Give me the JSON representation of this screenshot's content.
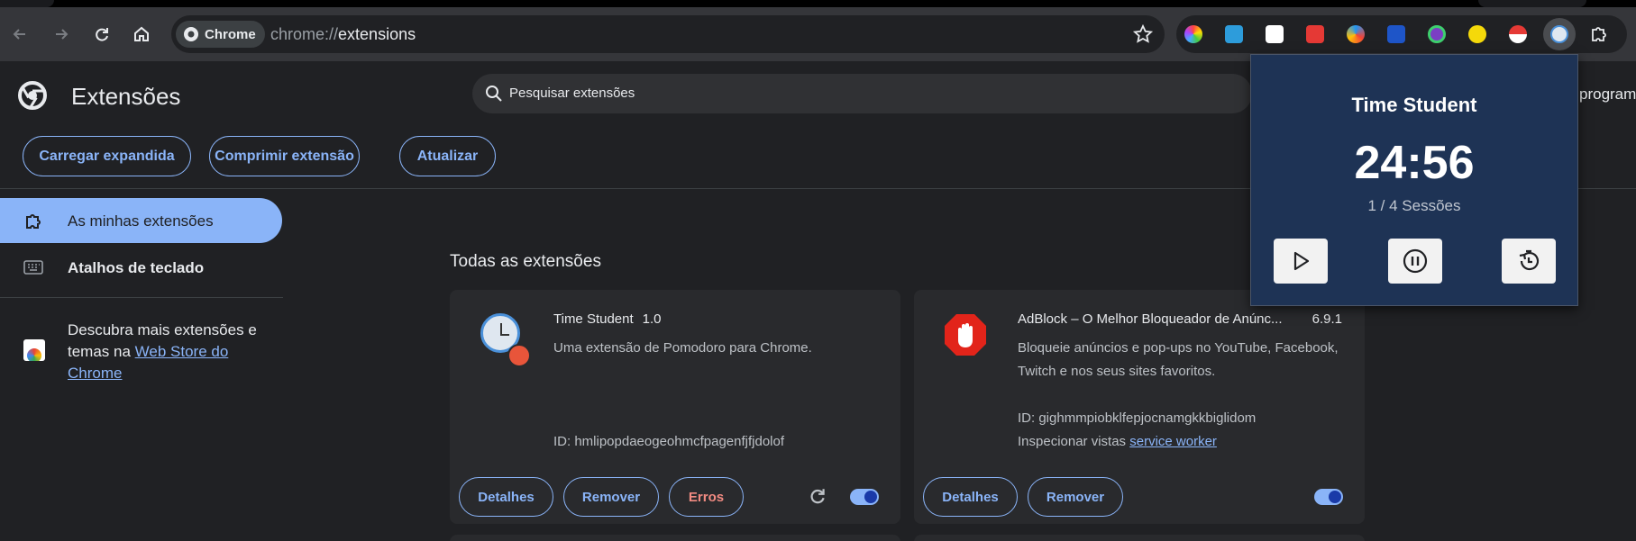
{
  "browser": {
    "chip_label": "Chrome",
    "url_prefix": "chrome://",
    "url_path": "extensions"
  },
  "toolbar_extensions": [
    "color-picker-icon",
    "cloud-icon",
    "keyhole-icon",
    "youtube-icon",
    "globe-icon",
    "translate-icon",
    "dollar-icon",
    "moon-icon",
    "pokeball-icon",
    "clock-icon",
    "puzzle-icon"
  ],
  "header": {
    "title": "Extensões",
    "search_placeholder": "Pesquisar extensões",
    "dev_mode_partial": "programa"
  },
  "actions": {
    "load_unpacked": "Carregar expandida",
    "pack": "Comprimir extensão",
    "update": "Atualizar"
  },
  "sidebar": {
    "items": [
      {
        "label": "As minhas extensões",
        "active": true
      },
      {
        "label": "Atalhos de teclado",
        "active": false
      }
    ],
    "promo_text": "Descubra mais extensões e temas na ",
    "promo_link": "Web Store do Chrome"
  },
  "section_title": "Todas as extensões",
  "extensions": [
    {
      "name": "Time Student",
      "version": "1.0",
      "description": "Uma extensão de Pomodoro para Chrome.",
      "id_line": "ID: hmlipopdaeogeohmcfpagenfjfjdolof",
      "buttons": [
        "Detalhes",
        "Remover",
        "Erros"
      ],
      "enabled": true
    },
    {
      "name": "AdBlock – O Melhor Bloqueador de Anúnc...",
      "version": "6.9.1",
      "description": "Bloqueie anúncios e pop-ups no YouTube, Facebook, Twitch e nos seus sites favoritos.",
      "id_line": "ID: gighmmpiobklfepjocnamgkkbiglidom",
      "inspect_label": "Inspecionar vistas ",
      "inspect_link": "service worker",
      "buttons": [
        "Detalhes",
        "Remover"
      ],
      "enabled": true
    }
  ],
  "popup": {
    "title": "Time Student",
    "timer": "24:56",
    "sessions": "1 / 4 Sessões"
  },
  "colors": {
    "accent": "#8ab4f8",
    "popup_bg": "#1e3355",
    "error": "#f28b82",
    "background": "#202124"
  }
}
